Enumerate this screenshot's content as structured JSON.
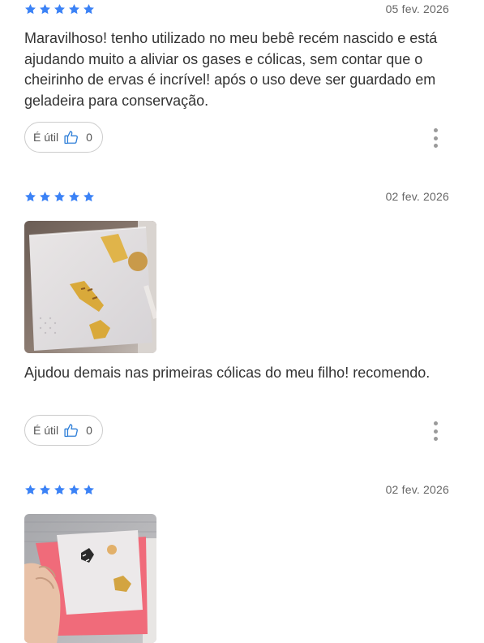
{
  "reviews": [
    {
      "rating": 5,
      "date": "05 fev. 2026",
      "text": "Maravilhoso! tenho utilizado no meu bebê recém nascido e está ajudando muito a aliviar os gases e cólicas, sem contar que o cheirinho de ervas é incrível! após o uso deve ser guardado em geladeira para conservação.",
      "useful_label": "É útil",
      "useful_count": "0"
    },
    {
      "rating": 5,
      "date": "02 fev. 2026",
      "text": "Ajudou demais nas primeiras cólicas do meu filho! recomendo.",
      "useful_label": "É útil",
      "useful_count": "0",
      "photo": "review-photo"
    },
    {
      "rating": 5,
      "date": "02 fev. 2026",
      "photo": "review-photo"
    }
  ],
  "colors": {
    "star": "#3b82f6",
    "thumb": "#2f7fd8",
    "dots": "#9a9a9a"
  },
  "icons": {
    "star": "star-icon",
    "thumb": "thumbs-up-icon",
    "more": "more-vertical-icon"
  }
}
